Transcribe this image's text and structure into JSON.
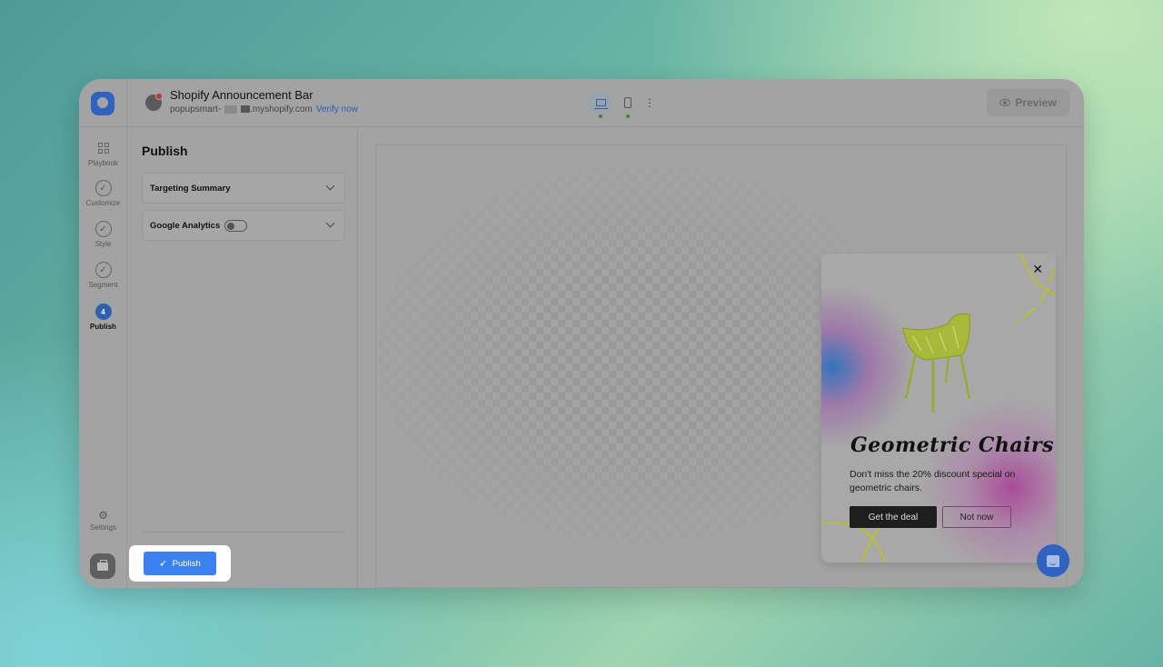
{
  "header": {
    "title": "Shopify Announcement Bar",
    "site_prefix": "popupsmart-",
    "site_suffix": ".myshopify.com",
    "verify_label": "Verify now",
    "devices": [
      {
        "name": "desktop",
        "active": true,
        "status": "green"
      },
      {
        "name": "mobile",
        "active": false,
        "status": "green"
      }
    ],
    "more_icon": "⋮",
    "preview_label": "Preview"
  },
  "nav": {
    "items": [
      {
        "label": "Playbook",
        "icon": "grid-icon"
      },
      {
        "label": "Customize",
        "icon": "check-circle-icon"
      },
      {
        "label": "Style",
        "icon": "check-circle-icon"
      },
      {
        "label": "Segment",
        "icon": "check-circle-icon"
      },
      {
        "label": "Publish",
        "icon": "step-number",
        "step": "4",
        "active": true
      }
    ],
    "settings_label": "Settings",
    "check_glyph": "✓",
    "gear_glyph": "⚙"
  },
  "panel": {
    "title": "Publish",
    "sections": [
      {
        "label": "Targeting Summary"
      },
      {
        "label": "Google Analytics",
        "toggle": false
      }
    ],
    "publish_label": "Publish",
    "rocket_glyph": "🚀"
  },
  "popup": {
    "title": "Geometric Chairs",
    "description": "Don't miss the 20% discount special on geometric chairs.",
    "primary_label": "Get the deal",
    "secondary_label": "Not now",
    "close_glyph": "✕",
    "accent_colors": {
      "chair": "#a8b83a",
      "primary_button": "#1e1e1e",
      "blob_blue": "#2b6ec0",
      "blob_pink": "#b03c96"
    }
  },
  "colors": {
    "brand": "#2f63bf",
    "publish_button": "#3a80ee",
    "verify_link": "#2b5fb8"
  }
}
